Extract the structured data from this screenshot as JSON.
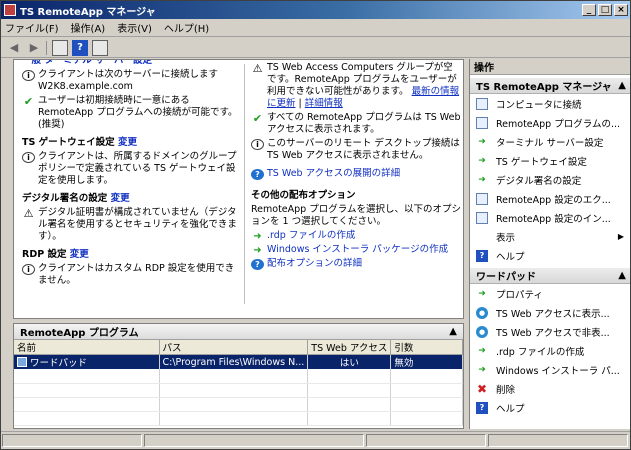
{
  "window": {
    "title": "TS RemoteApp マネージャ"
  },
  "menu": [
    "ファイル(F)",
    "操作(A)",
    "表示(V)",
    "ヘルプ(H)"
  ],
  "main": {
    "left": {
      "frag_top": "一般 ターミナル サーバー設定",
      "row1": "クライアントは次のサーバーに接続します W2K8.example.com",
      "row2": "ユーザーは初期接続時に一意にある RemoteApp プログラムへの接続が可能です。(推奨)",
      "gateway_title": "TS ゲートウェイ設定",
      "gateway_change": "変更",
      "gateway_text": "クライアントは、所属するドメインのグループ ポリシーで定義されている TS ゲートウェイ設定を使用します。",
      "sign_title": "デジタル署名の設定",
      "sign_change": "変更",
      "sign_text": "デジタル証明書が構成されていません（デジタル署名を使用するとセキュリティを強化できます）。",
      "rdp_title": "RDP 設定",
      "rdp_change": "変更",
      "rdp_text": "クライアントはカスタム RDP 設定を使用できません。"
    },
    "right": {
      "ts_web_1": "TS Web Access Computers グループが空です。RemoteApp プログラムをユーザーが利用できない可能性があります。",
      "ts_web_1_link": "最新の情報に更新",
      "ts_web_1_detail": "詳細情報",
      "row2": "すべての RemoteApp プログラムは TS Web アクセスに表示されます。",
      "row3": "このサーバーのリモート デスクトップ接続は TS Web アクセスに表示されません。",
      "ts_web_link": "TS Web アクセスの展開の詳細",
      "other_title": "その他の配布オプション",
      "other_text": "RemoteApp プログラムを選択し、以下のオプションを 1 つ選択してください。",
      "opt1": ".rdp ファイルの作成",
      "opt2": "Windows インストーラ パッケージの作成",
      "opt3": "配布オプションの詳細"
    }
  },
  "programs": {
    "header": "RemoteApp プログラム",
    "columns": [
      "名前",
      "パス",
      "TS Web アクセス",
      "引数"
    ],
    "rows": [
      {
        "name": "ワードパッド",
        "path": "C:\\Program Files\\Windows N...",
        "tsweb": "はい",
        "args": "無効"
      }
    ]
  },
  "actions": {
    "header": "操作",
    "section1": "TS RemoteApp マネージャ",
    "items1": [
      {
        "label": "コンピュータに接続",
        "icon": "computer-icon"
      },
      {
        "label": "RemoteApp プログラムの...",
        "icon": "doc-icon"
      },
      {
        "label": "ターミナル サーバー設定",
        "icon": "green-arrow-icon"
      },
      {
        "label": "TS ゲートウェイ設定",
        "icon": "green-arrow-icon"
      },
      {
        "label": "デジタル署名の設定",
        "icon": "green-arrow-icon"
      },
      {
        "label": "RemoteApp 設定のエク...",
        "icon": "doc-icon"
      },
      {
        "label": "RemoteApp 設定のイン...",
        "icon": "doc-icon"
      },
      {
        "label": "表示",
        "icon": "none"
      },
      {
        "label": "ヘルプ",
        "icon": "help-icon"
      }
    ],
    "section2": "ワードパッド",
    "items2": [
      {
        "label": "プロパティ",
        "icon": "green-arrow-icon"
      },
      {
        "label": "TS Web アクセスに表示...",
        "icon": "globe-icon"
      },
      {
        "label": "TS Web アクセスで非表...",
        "icon": "globe-icon"
      },
      {
        "label": ".rdp ファイルの作成",
        "icon": "green-arrow-icon"
      },
      {
        "label": "Windows インストーラ パ...",
        "icon": "green-arrow-icon"
      },
      {
        "label": "削除",
        "icon": "delete-icon"
      },
      {
        "label": "ヘルプ",
        "icon": "help-icon"
      }
    ]
  }
}
